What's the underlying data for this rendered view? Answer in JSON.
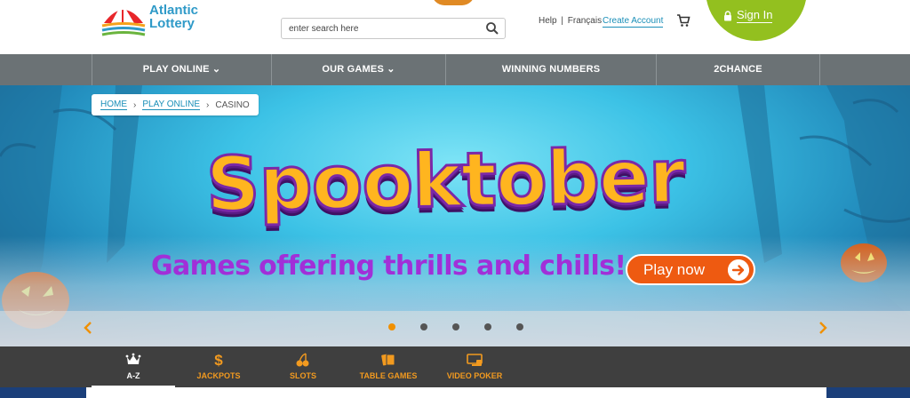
{
  "header": {
    "logo_text_line1": "Atlantic",
    "logo_text_line2": "Lottery",
    "search_placeholder": "enter search here",
    "help_label": "Help",
    "separator": "|",
    "francais_label": "Français",
    "create_account_label": "Create Account",
    "sign_in_label": "Sign In"
  },
  "nav": {
    "items": [
      {
        "label": "PLAY ONLINE ⌄"
      },
      {
        "label": "OUR GAMES ⌄"
      },
      {
        "label": "WINNING NUMBERS"
      },
      {
        "label": "2CHANCE"
      }
    ]
  },
  "breadcrumb": {
    "items": [
      "HOME",
      "PLAY ONLINE",
      "CASINO"
    ],
    "separator": "›"
  },
  "hero": {
    "title": "Spooktober",
    "subtitle": "Games offering thrills and chills!",
    "cta_label": "Play now",
    "slide_count": 5,
    "active_slide": 1,
    "colors": {
      "title": "#ffb51f",
      "title_outline": "#7b28a8",
      "subtitle": "#a12fd8",
      "cta": "#ee5a11",
      "active_dot": "#f09000"
    }
  },
  "categories": {
    "items": [
      {
        "label": "A-Z",
        "icon": "crown-icon",
        "active": true
      },
      {
        "label": "JACKPOTS",
        "icon": "dollar-icon",
        "active": false
      },
      {
        "label": "SLOTS",
        "icon": "cherries-icon",
        "active": false
      },
      {
        "label": "TABLE GAMES",
        "icon": "cards-icon",
        "active": false
      },
      {
        "label": "VIDEO POKER",
        "icon": "monitor-icon",
        "active": false
      }
    ],
    "accent_color": "#f29a1f"
  }
}
